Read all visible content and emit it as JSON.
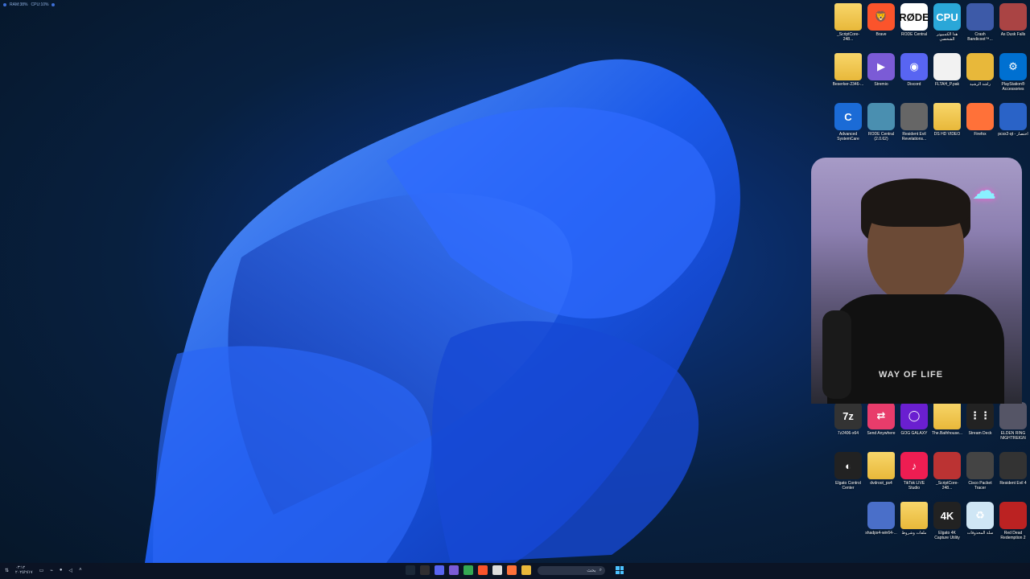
{
  "perf_overlay": {
    "ram": "RAM:38%",
    "cpu": "CPU:10%"
  },
  "desktop_icons": [
    {
      "label": "_ScriptCore-248...",
      "icon": "folder",
      "color": "#e8b83a"
    },
    {
      "label": "Brave",
      "icon": "brave-icon",
      "color": "#fb542b",
      "text": "🦁"
    },
    {
      "label": "RODE Central",
      "icon": "rode-icon",
      "color": "#ffffff",
      "text": "RØDE"
    },
    {
      "label": "هذا الكمبيوتر الشخصي",
      "icon": "computer-icon",
      "color": "#2aa7d8",
      "text": "CPU"
    },
    {
      "label": "Crash Bandicoot™...",
      "icon": "game-icon",
      "color": "#3d5aa8",
      "text": ""
    },
    {
      "label": "As Dusk Falls",
      "icon": "game-icon",
      "color": "#a44",
      "text": ""
    },
    {
      "label": "Beserker-2346-...",
      "icon": "folder",
      "color": "#e8b83a"
    },
    {
      "label": "Stremio",
      "icon": "stremio-icon",
      "color": "#7b5bd6",
      "text": "▶"
    },
    {
      "label": "Discord",
      "icon": "discord-icon",
      "color": "#5865f2",
      "text": "◉"
    },
    {
      "label": "FLTAH_P.pak",
      "icon": "file-icon",
      "color": "#f2f2f2",
      "text": ""
    },
    {
      "label": "راشد الرشيد",
      "icon": "user-folder-icon",
      "color": "#e8b83a",
      "text": ""
    },
    {
      "label": "PlayStation® Accessories",
      "icon": "playstation-icon",
      "color": "#0070d1",
      "text": "⚙"
    },
    {
      "label": "Advanced SystemCare",
      "icon": "asc-icon",
      "color": "#1b6bd6",
      "text": "C"
    },
    {
      "label": "RODE Central (2.0.62)",
      "icon": "rode-icon",
      "color": "#4a8fb0",
      "text": ""
    },
    {
      "label": "Resident Evil Revelations...",
      "icon": "game-icon",
      "color": "#666",
      "text": ""
    },
    {
      "label": "DS HD VIDEO",
      "icon": "folder",
      "color": "#e8b83a"
    },
    {
      "label": "Firefox",
      "icon": "firefox-icon",
      "color": "#ff7139",
      "text": ""
    },
    {
      "label": "pcsx2-qt - اختصار",
      "icon": "pcsx2-icon",
      "color": "#2a63c7",
      "text": ""
    },
    {
      "label": "7z2406-x64",
      "icon": "7zip-icon",
      "color": "#333",
      "text": "7z"
    },
    {
      "label": "Send Anywhere",
      "icon": "send-anywhere-icon",
      "color": "#e83c6b",
      "text": "⇄"
    },
    {
      "label": "GOG GALAXY",
      "icon": "gog-icon",
      "color": "#6a1fd0",
      "text": "◯"
    },
    {
      "label": "The.Bathhouse...",
      "icon": "folder",
      "color": "#e8b83a"
    },
    {
      "label": "Stream Deck",
      "icon": "stream-deck-icon",
      "color": "#222",
      "text": "⋮⋮"
    },
    {
      "label": "ELDEN RING NIGHTREIGN",
      "icon": "game-icon",
      "color": "#556",
      "text": ""
    },
    {
      "label": "Elgato Control Center",
      "icon": "elgato-icon",
      "color": "#222",
      "text": "◐"
    },
    {
      "label": "dvdroot_ps4",
      "icon": "folder",
      "color": "#e8b83a"
    },
    {
      "label": "TikTok LIVE Studio",
      "icon": "tiktok-icon",
      "color": "#ee1d52",
      "text": "♪"
    },
    {
      "label": "_ScriptCore-248...",
      "icon": "archive-icon",
      "color": "#b33",
      "text": ""
    },
    {
      "label": "Cisco Packet Tracer",
      "icon": "cisco-icon",
      "color": "#444",
      "text": ""
    },
    {
      "label": "Resident Evil 4",
      "icon": "game-icon",
      "color": "#333",
      "text": ""
    },
    {
      "label": "shadps4-win64-...",
      "icon": "shadps4-icon",
      "color": "#4a6fc9",
      "text": ""
    },
    {
      "label": "ملفات وشروط",
      "icon": "folder",
      "color": "#e8b83a"
    },
    {
      "label": "Elgato 4K Capture Utility",
      "icon": "elgato-4k-icon",
      "color": "#222",
      "text": "4K"
    },
    {
      "label": "سلة المحذوفات",
      "icon": "recycle-bin-icon",
      "color": "#cfe6f5",
      "text": "♻"
    },
    {
      "label": "Red Dead Redemption 2",
      "icon": "game-icon",
      "color": "#b22",
      "text": ""
    }
  ],
  "webcam": {
    "shirt_text": "WAY OF LIFE"
  },
  "taskbar": {
    "clock_time": "٠٣:١٢",
    "clock_date": "٢٠٢٥/٦/١٧",
    "search_placeholder": "بحث",
    "apps": [
      {
        "icon": "steam-icon",
        "color": "#1b2838"
      },
      {
        "icon": "obs-icon",
        "color": "#302e31"
      },
      {
        "icon": "discord-icon",
        "color": "#5865f2"
      },
      {
        "icon": "stremio-icon",
        "color": "#7b5bd6"
      },
      {
        "icon": "chrome-icon",
        "color": "#34a853"
      },
      {
        "icon": "brave-icon",
        "color": "#fb542b"
      },
      {
        "icon": "notion-icon",
        "color": "#ddd"
      },
      {
        "icon": "firefox-icon",
        "color": "#ff7139"
      },
      {
        "icon": "file-explorer-icon",
        "color": "#e8b83a"
      }
    ]
  }
}
